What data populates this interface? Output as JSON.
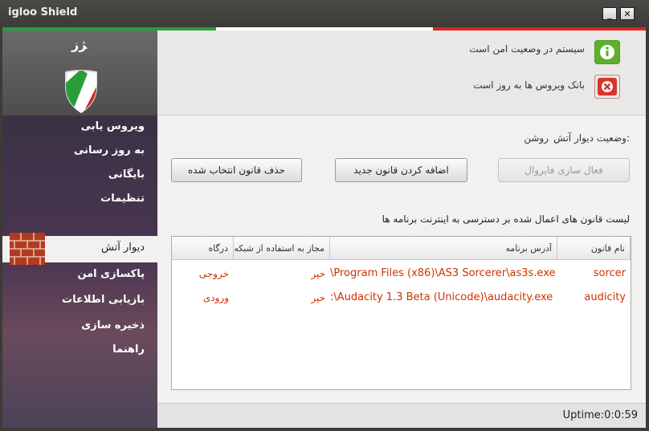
{
  "window": {
    "title": "igloo Shield",
    "minimize_glyph": "_",
    "maximize_glyph": "□",
    "close_glyph": "✕",
    "flag_colors": [
      "#2a9d3a",
      "#ffffff",
      "#d32a1e"
    ]
  },
  "logo": {
    "mark_text": "ﮋز",
    "icon": "shield-flag-icon"
  },
  "sidebar": {
    "items": [
      {
        "label": "ویروس یابی"
      },
      {
        "label": "به روز رسانی"
      },
      {
        "label": "بایگانی"
      },
      {
        "label": "تنظیمات"
      }
    ],
    "selected": {
      "label": "دیوار آتش",
      "icon": "brick-wall-icon"
    },
    "items2": [
      {
        "label": "پاکسازی امن"
      },
      {
        "label": "بازیابی اطلاعات"
      },
      {
        "label": "ذخیره سازی"
      },
      {
        "label": "راهنما"
      }
    ]
  },
  "status": {
    "system": {
      "text": "سیستم در وضعیت امن است",
      "icon": "info-icon",
      "color": "#5fae2e"
    },
    "virusdb": {
      "text": "بانک ویروس ها به روز است",
      "icon": "error-icon",
      "color": "#d9342b"
    }
  },
  "firewall": {
    "status_label": "وضعیت دیوار آتش:",
    "status_value": "روشن",
    "buttons": {
      "activate": "فعال سازی فایروال",
      "add_rule": "اضافه کردن قانون جدید",
      "delete_rule": "حذف قانون انتخاب شده"
    },
    "list_caption": "لیست قانون های اعمال شده بر دسترسی به اینترنت برنامه ها",
    "columns": [
      "نام قانون",
      "آدرس برنامه",
      "مجاز به استفاده از شبکه",
      "درگاه"
    ],
    "rules": [
      {
        "name": "sorcer",
        "path": "\\Program Files (x86)\\AS3 Sorcerer\\as3s.exe",
        "allowed": "خیر",
        "port": "خروجی"
      },
      {
        "name": "audicity",
        "path": ":\\Audacity 1.3 Beta (Unicode)\\audacity.exe",
        "allowed": "خیر",
        "port": "ورودی"
      }
    ]
  },
  "footer": {
    "uptime": "Uptime:0:0:59"
  },
  "accent": {
    "rule_text": "#cc3300",
    "sidebar_bg": "#4b3552"
  }
}
